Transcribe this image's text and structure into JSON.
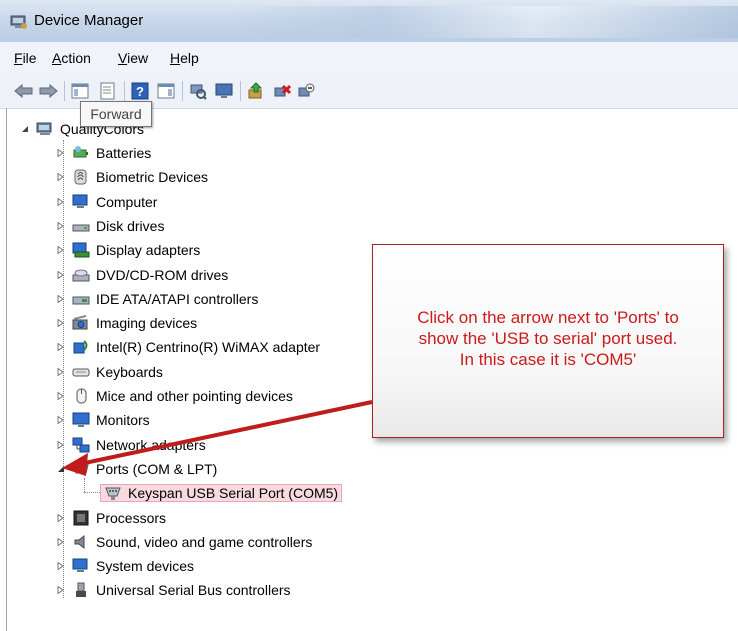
{
  "window": {
    "title": "Device Manager"
  },
  "menu": [
    {
      "label": "File",
      "key": "F",
      "rest": "ile"
    },
    {
      "label": "Action",
      "key": "A",
      "rest": "ction"
    },
    {
      "label": "View",
      "key": "V",
      "rest": "iew"
    },
    {
      "label": "Help",
      "key": "H",
      "rest": "elp"
    }
  ],
  "tooltip": "Forward",
  "tree": {
    "root": "QualityColors",
    "items": [
      {
        "label": "Batteries",
        "icon": "battery-icon"
      },
      {
        "label": "Biometric Devices",
        "icon": "fingerprint-icon"
      },
      {
        "label": "Computer",
        "icon": "computer-icon"
      },
      {
        "label": "Disk drives",
        "icon": "disk-drive-icon"
      },
      {
        "label": "Display adapters",
        "icon": "display-adapter-icon"
      },
      {
        "label": "DVD/CD-ROM drives",
        "icon": "dvd-drive-icon"
      },
      {
        "label": "IDE ATA/ATAPI controllers",
        "icon": "ide-controller-icon"
      },
      {
        "label": "Imaging devices",
        "icon": "camera-icon"
      },
      {
        "label": "Intel(R) Centrino(R) WiMAX adapter",
        "icon": "wimax-icon"
      },
      {
        "label": "Keyboards",
        "icon": "keyboard-icon"
      },
      {
        "label": "Mice and other pointing devices",
        "icon": "mouse-icon"
      },
      {
        "label": "Monitors",
        "icon": "monitor-icon"
      },
      {
        "label": "Network adapters",
        "icon": "network-icon"
      },
      {
        "label": "Ports (COM & LPT)",
        "icon": "port-icon",
        "expanded": true
      },
      {
        "label": "Keyspan USB Serial Port (COM5)",
        "icon": "serial-port-icon",
        "child": true,
        "selected": true
      },
      {
        "label": "Processors",
        "icon": "processor-icon"
      },
      {
        "label": "Sound, video and game controllers",
        "icon": "speaker-icon"
      },
      {
        "label": "System devices",
        "icon": "system-icon"
      },
      {
        "label": "Universal Serial Bus controllers",
        "icon": "usb-icon"
      }
    ]
  },
  "callout": {
    "lines": [
      "Click on the arrow next to 'Ports' to",
      "show the 'USB to serial' port used.",
      "In this case it is 'COM5'"
    ],
    "text_color": "#cc1a1a",
    "border_color": "#b02020"
  }
}
